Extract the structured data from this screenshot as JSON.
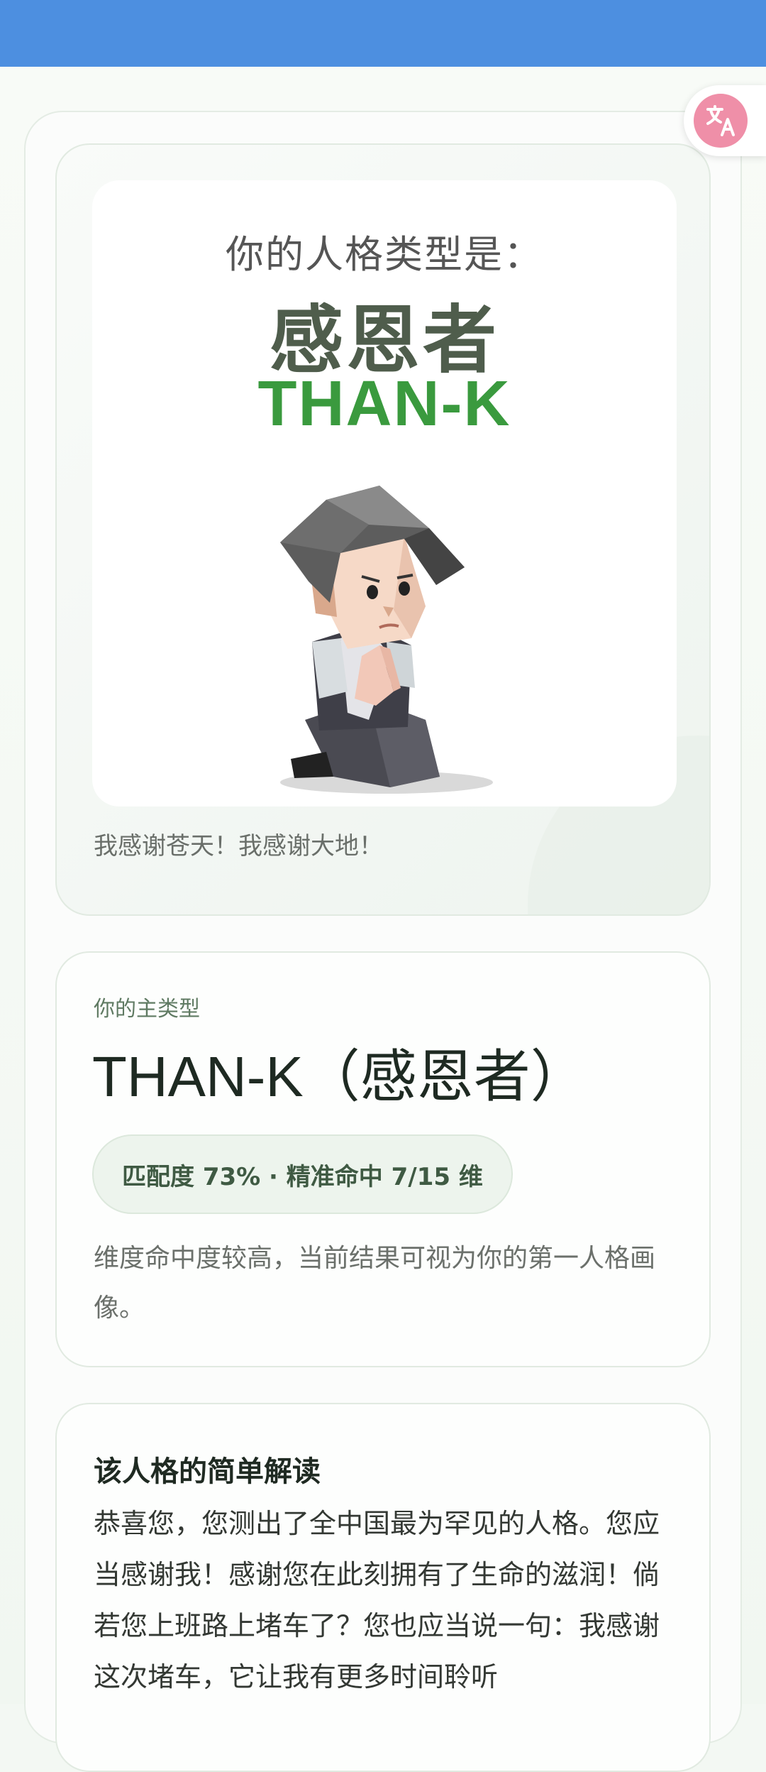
{
  "colors": {
    "topbar": "#4d8fe0",
    "accent_green": "#3a9a3e",
    "translate_button": "#ef8fa8"
  },
  "translate": {
    "icon": "translate-icon"
  },
  "result_image": {
    "heading": "你的人格类型是：",
    "name_cn": "感恩者",
    "name_en": "THAN-K",
    "character_icon": "kneeling-praying-figure"
  },
  "caption": "我感谢苍天！我感谢大地！",
  "main_type": {
    "label": "你的主类型",
    "title": "THAN-K（感恩者）",
    "match_badge": "匹配度 73% · 精准命中 7/15 维",
    "description": "维度命中度较高，当前结果可视为你的第一人格画像。"
  },
  "interpretation": {
    "title": "该人格的简单解读",
    "body": "恭喜您，您测出了全中国最为罕见的人格。您应当感谢我！感谢您在此刻拥有了生命的滋润！倘若您上班路上堵车了？您也应当说一句：我感谢这次堵车，它让我有更多时间聆听"
  }
}
